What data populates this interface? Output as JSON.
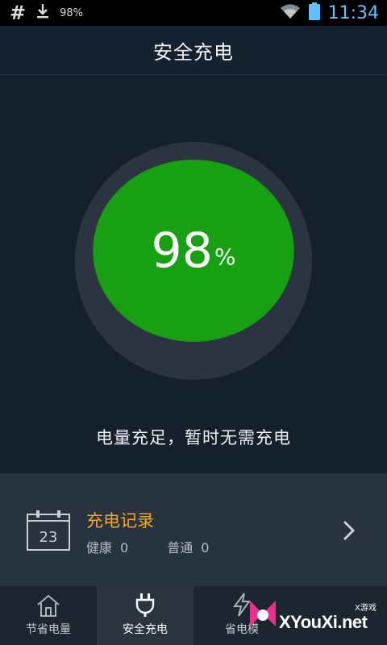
{
  "status_bar": {
    "notification_icons": [
      "hash-icon",
      "download-icon"
    ],
    "battery_text": "98%",
    "time": "11:34",
    "wifi_icon": "wifi-icon",
    "battery_icon": "battery-icon"
  },
  "header": {
    "title": "安全充电"
  },
  "gauge": {
    "value": "98",
    "unit": "%",
    "level": 0.98,
    "fill_color": "#17a012",
    "ring_color": "#2c3442"
  },
  "status_message": "电量充足，暂时无需充电",
  "charge_record": {
    "icon": "calendar-icon",
    "calendar_day": "23",
    "title": "充电记录",
    "healthy_label": "健康",
    "healthy_count": "0",
    "normal_label": "普通",
    "normal_count": "0"
  },
  "tabs": [
    {
      "label": "节省电量",
      "icon": "home-icon",
      "active": false
    },
    {
      "label": "安全充电",
      "icon": "plug-icon",
      "active": true
    },
    {
      "label": "省电模",
      "icon": "lightning-icon",
      "active": false
    }
  ],
  "watermark": {
    "brand": "XYouXi.net",
    "tagline": "X游戏"
  },
  "colors": {
    "accent": "#f7a51c",
    "background": "#14202c",
    "time_color": "#5fc2ff"
  }
}
